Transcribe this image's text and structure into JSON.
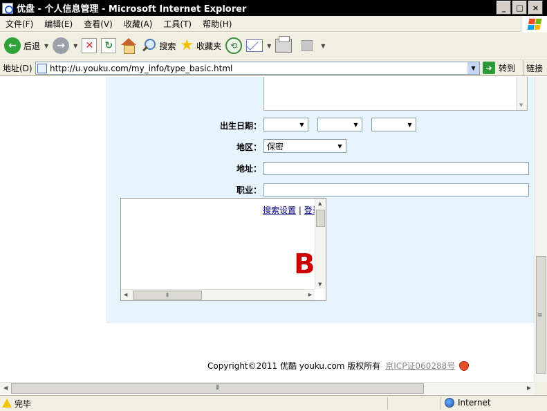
{
  "window": {
    "title": "优盘 - 个人信息管理 - Microsoft Internet Explorer",
    "minimize_symbol": "_",
    "maximize_symbol": "□",
    "close_symbol": "×"
  },
  "menu": {
    "items": [
      "文件(F)",
      "编辑(E)",
      "查看(V)",
      "收藏(A)",
      "工具(T)",
      "帮助(H)"
    ]
  },
  "toolbar": {
    "back_label": "后退",
    "search_label": "搜索",
    "favorites_label": "收藏夹",
    "icons": [
      "back-arrow",
      "forward-arrow",
      "stop",
      "refresh",
      "home",
      "search",
      "favorites-star",
      "history",
      "mail",
      "print",
      "edit"
    ]
  },
  "address": {
    "label": "地址(D)",
    "url": "http://u.youku.com/my_info/type_basic.html",
    "go_label": "转到",
    "links_label": "链接"
  },
  "form": {
    "birthday_label": "出生日期：",
    "region_label": "地区：",
    "region_value": "保密",
    "address_label": "地址：",
    "occupation_label": "职业："
  },
  "frame": {
    "search_settings_link": "搜索设置",
    "separator": "|",
    "login_link": "登录",
    "logo_text": "B"
  },
  "footer": {
    "copyright": "Copyright©2011 优酷 youku.com 版权所有",
    "icp": "京ICP证060288号"
  },
  "status": {
    "text": "完毕",
    "zone": "Internet"
  },
  "colors": {
    "panel_bg": "#e8f4fd",
    "chrome_bg": "#f1efe2",
    "logo_red": "#cc0000",
    "link_blue": "#000080"
  }
}
